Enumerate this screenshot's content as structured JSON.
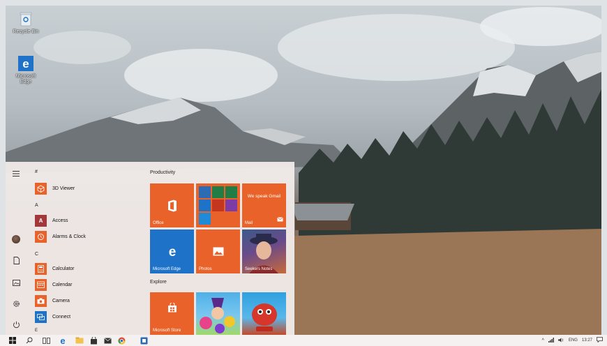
{
  "desktop": {
    "icons": [
      {
        "label": "Recycle Bin",
        "icon": "recycle-bin-icon"
      },
      {
        "label": "Microsoft Edge",
        "icon": "edge-icon"
      }
    ]
  },
  "start_menu": {
    "rail": {
      "menu": "hamburger-icon",
      "user": "avatar",
      "documents": "document-icon",
      "pictures": "pictures-icon",
      "settings": "gear-icon",
      "power": "power-icon"
    },
    "groups": [
      {
        "letter": "#",
        "apps": [
          {
            "name": "3D Viewer",
            "color": "#e8622a"
          }
        ]
      },
      {
        "letter": "A",
        "apps": [
          {
            "name": "Access",
            "color": "#a4373a"
          },
          {
            "name": "Alarms & Clock",
            "color": "#e8622a"
          }
        ]
      },
      {
        "letter": "C",
        "apps": [
          {
            "name": "Calculator",
            "color": "#e8622a"
          },
          {
            "name": "Calendar",
            "color": "#e8622a"
          },
          {
            "name": "Camera",
            "color": "#e8622a"
          },
          {
            "name": "Connect",
            "color": "#1e72c8"
          }
        ]
      },
      {
        "letter": "E",
        "apps": []
      }
    ],
    "tiles": {
      "productivity_header": "Productivity",
      "explore_header": "Explore",
      "office": "Office",
      "mail_text": "We speak Gmail",
      "mail": "Mail",
      "edge": "Microsoft Edge",
      "photos": "Photos",
      "seekers": "Seekers Notes",
      "store": "Microsoft Store",
      "colors": {
        "accent": "#e8622a",
        "edge_blue": "#1e72c8"
      }
    }
  },
  "taskbar": {
    "items": [
      "start-icon",
      "search-icon",
      "task-view-icon",
      "edge-icon",
      "file-explorer-icon",
      "store-icon",
      "mail-icon",
      "chrome-icon",
      "app-icon"
    ],
    "language": "ENG",
    "time": "13:27"
  }
}
